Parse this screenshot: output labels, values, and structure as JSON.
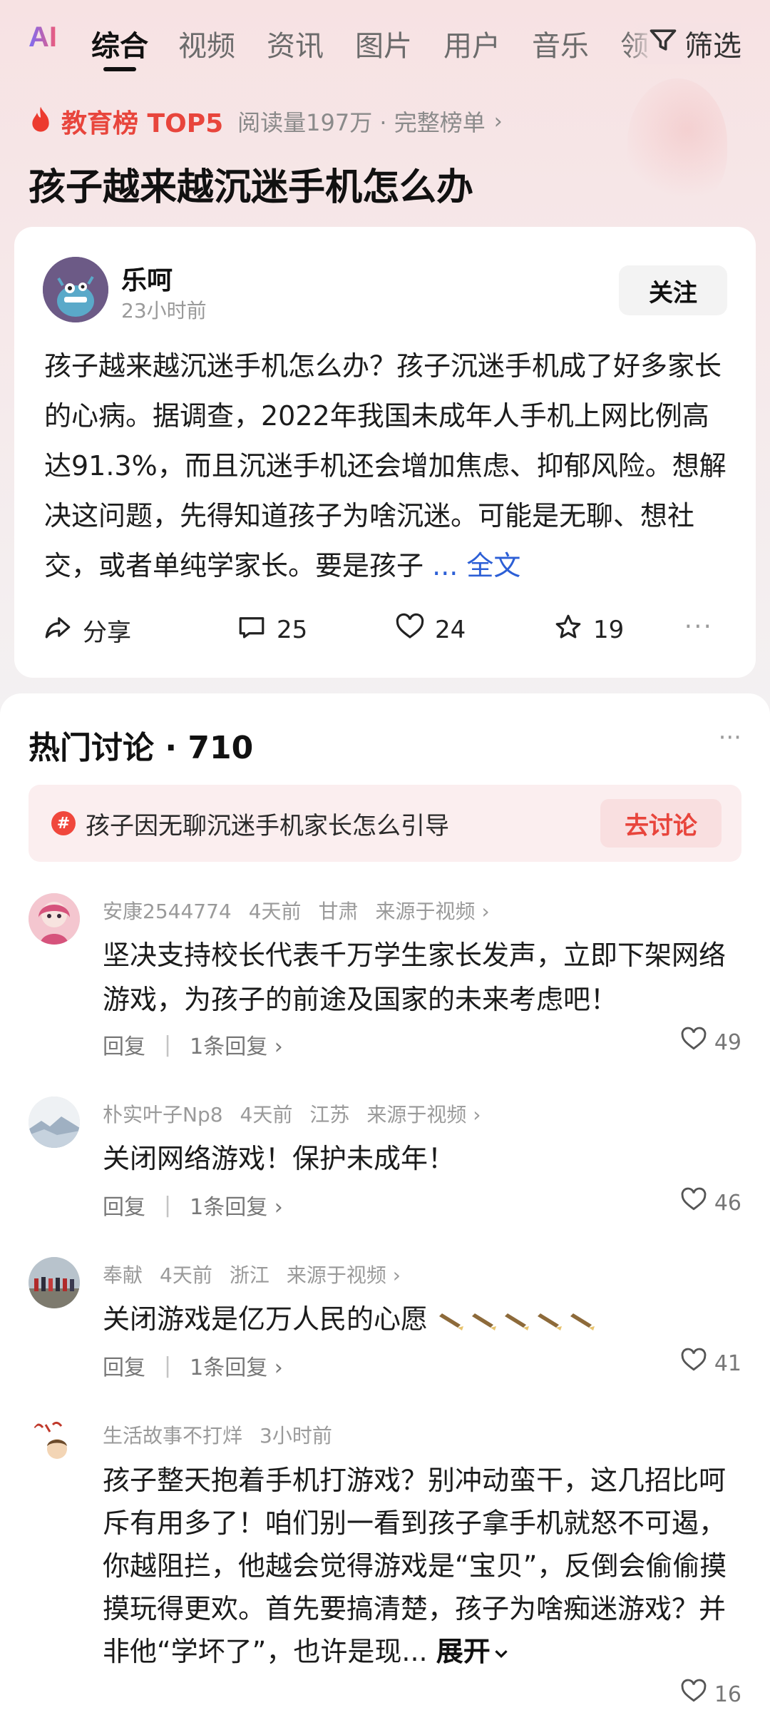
{
  "tabs": {
    "ai_logo": "AI",
    "items": [
      "综合",
      "视频",
      "资讯",
      "图片",
      "用户",
      "音乐",
      "领"
    ],
    "filter_label": "筛选"
  },
  "rank": {
    "title": "教育榜 TOP5",
    "meta": "阅读量197万 · 完整榜单",
    "chevron": "›"
  },
  "query": {
    "title": "孩子越来越沉迷手机怎么办"
  },
  "article": {
    "author": "乐呵",
    "time": "23小时前",
    "follow_label": "关注",
    "body": "孩子越来越沉迷手机怎么办？孩子沉迷手机成了好多家长的心病。据调查，2022年我国未成年人手机上网比例高达91.3%，而且沉迷手机还会增加焦虑、抑郁风险。想解决这问题，先得知道孩子为啥沉迷。可能是无聊、想社交，或者单纯学家长。要是孩子",
    "more_label": "... 全文",
    "actions": {
      "share": "分享",
      "comments": "25",
      "likes": "24",
      "favorites": "19",
      "more": "···"
    }
  },
  "discussion": {
    "title": "热门讨论 · 710",
    "more": "···",
    "topic": {
      "text": "孩子因无聊沉迷手机家长怎么引导",
      "button": "去讨论",
      "icon": "#"
    },
    "comments": [
      {
        "user": "安康2544774",
        "time": "4天前",
        "location": "甘肃",
        "source": "来源于视频 ›",
        "text": "坚决支持校长代表千万学生家长发声，立即下架网络游戏，为孩子的前途及国家的未来考虑吧！",
        "reply": "回复",
        "reply_count": "1条回复 ›",
        "likes": "49"
      },
      {
        "user": "朴实叶子Np8",
        "time": "4天前",
        "location": "江苏",
        "source": "来源于视频 ›",
        "text": "关闭网络游戏！保护未成年！",
        "reply": "回复",
        "reply_count": "1条回复 ›",
        "likes": "46"
      },
      {
        "user": "奉献",
        "time": "4天前",
        "location": "浙江",
        "source": "来源于视频 ›",
        "text": "关闭游戏是亿万人民的心愿",
        "reply": "回复",
        "reply_count": "1条回复 ›",
        "likes": "41"
      },
      {
        "user": "生活故事不打烊",
        "time": "3小时前",
        "text": "孩子整天抱着手机打游戏？别冲动蛮干，这几招比呵斥有用多了！咱们别一看到孩子拿手机就怒不可遏，你越阻拦，他越会觉得游戏是“宝贝”，反倒会偷偷摸摸玩得更欢。首先要搞清楚，孩子为啥痴迷游戏？并非他“学坏了”，也许是现...",
        "expand": "展开",
        "likes": "16"
      }
    ]
  }
}
